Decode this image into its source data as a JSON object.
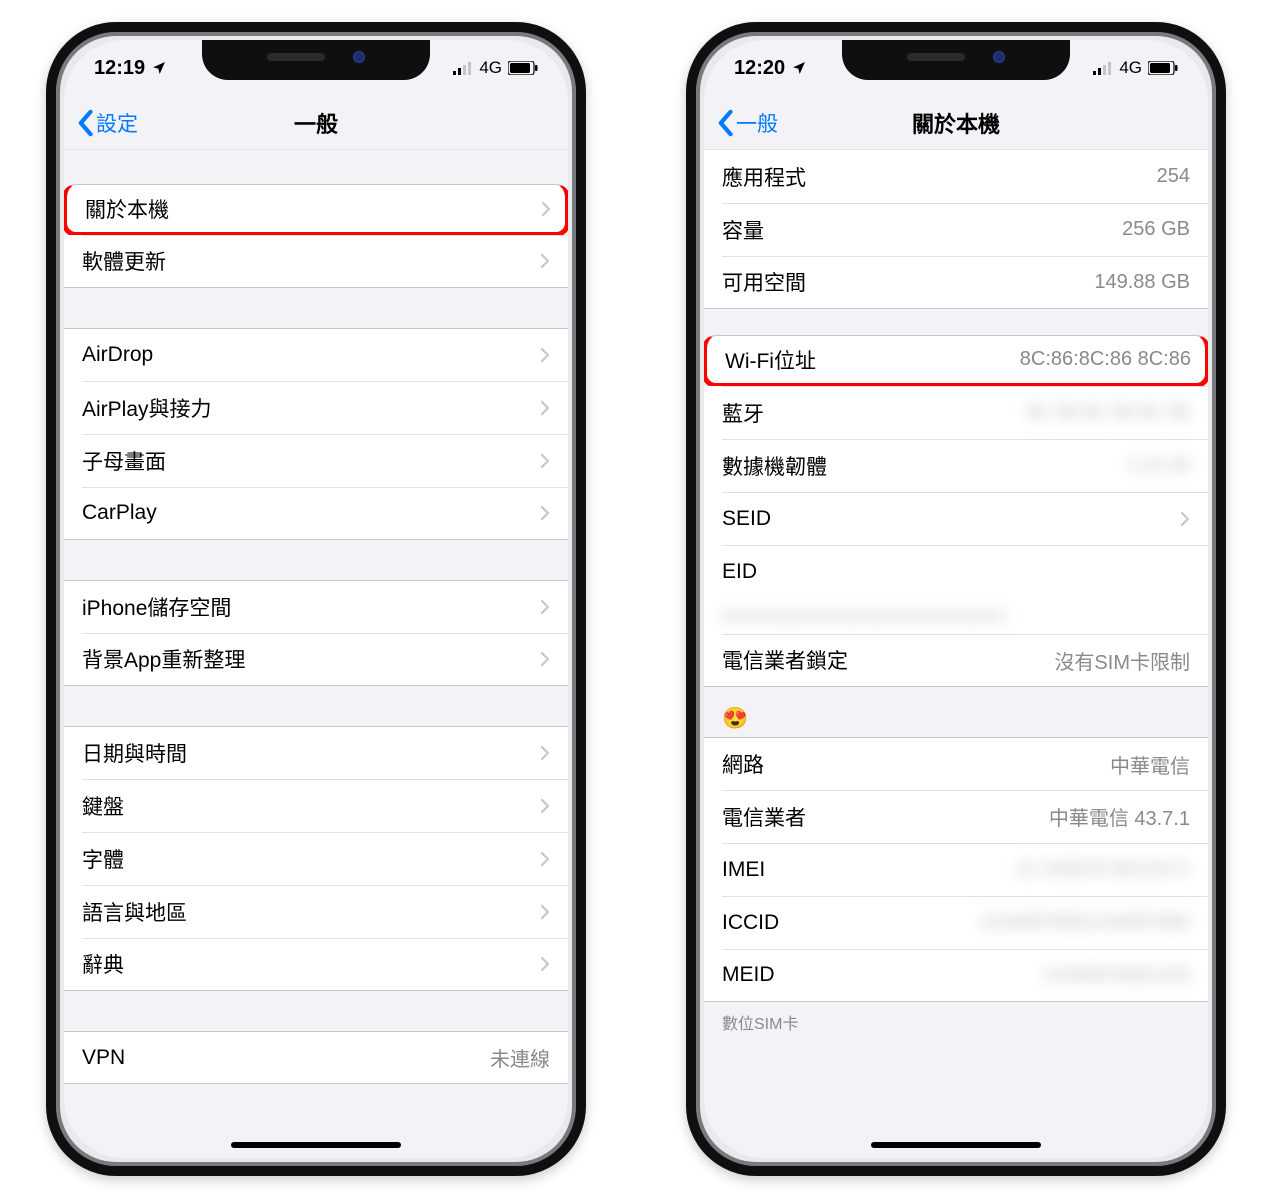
{
  "left": {
    "status": {
      "time": "12:19",
      "net": "4G"
    },
    "nav": {
      "back": "設定",
      "title": "一般"
    },
    "g1": [
      {
        "label": "關於本機",
        "chev": true,
        "hl": true
      },
      {
        "label": "軟體更新",
        "chev": true
      }
    ],
    "g2": [
      {
        "label": "AirDrop",
        "chev": true
      },
      {
        "label": "AirPlay與接力",
        "chev": true
      },
      {
        "label": "子母畫面",
        "chev": true
      },
      {
        "label": "CarPlay",
        "chev": true
      }
    ],
    "g3": [
      {
        "label": "iPhone儲存空間",
        "chev": true
      },
      {
        "label": "背景App重新整理",
        "chev": true
      }
    ],
    "g4": [
      {
        "label": "日期與時間",
        "chev": true
      },
      {
        "label": "鍵盤",
        "chev": true
      },
      {
        "label": "字體",
        "chev": true
      },
      {
        "label": "語言與地區",
        "chev": true
      },
      {
        "label": "辭典",
        "chev": true
      }
    ],
    "g5": [
      {
        "label": "VPN",
        "value": "未連線"
      }
    ]
  },
  "right": {
    "status": {
      "time": "12:20",
      "net": "4G"
    },
    "nav": {
      "back": "一般",
      "title": "關於本機"
    },
    "g1": [
      {
        "label": "應用程式",
        "value": "254"
      },
      {
        "label": "容量",
        "value": "256 GB"
      },
      {
        "label": "可用空間",
        "value": "149.88 GB"
      }
    ],
    "g2": [
      {
        "label": "Wi-Fi位址",
        "value": "8C:86:8C:86 8C:86",
        "hl": true
      },
      {
        "label": "藍牙",
        "blur": "8C 86 8C 86 8C 86"
      },
      {
        "label": "數據機韌體",
        "blur": "1.23.45"
      },
      {
        "label": "SEID",
        "chev": true
      },
      {
        "label": "EID",
        "blur_below": "89049032000000000000000000000000"
      },
      {
        "label": "電信業者鎖定",
        "value": "沒有SIM卡限制"
      }
    ],
    "g3_header": "😍",
    "g3": [
      {
        "label": "網路",
        "value": "中華電信"
      },
      {
        "label": "電信業者",
        "value": "中華電信 43.7.1"
      },
      {
        "label": "IMEI",
        "blur": "12 345678 901234 5"
      },
      {
        "label": "ICCID",
        "blur": "12345678901234567890"
      },
      {
        "label": "MEID",
        "blur": "12345678901234"
      }
    ],
    "footer": "數位SIM卡"
  }
}
